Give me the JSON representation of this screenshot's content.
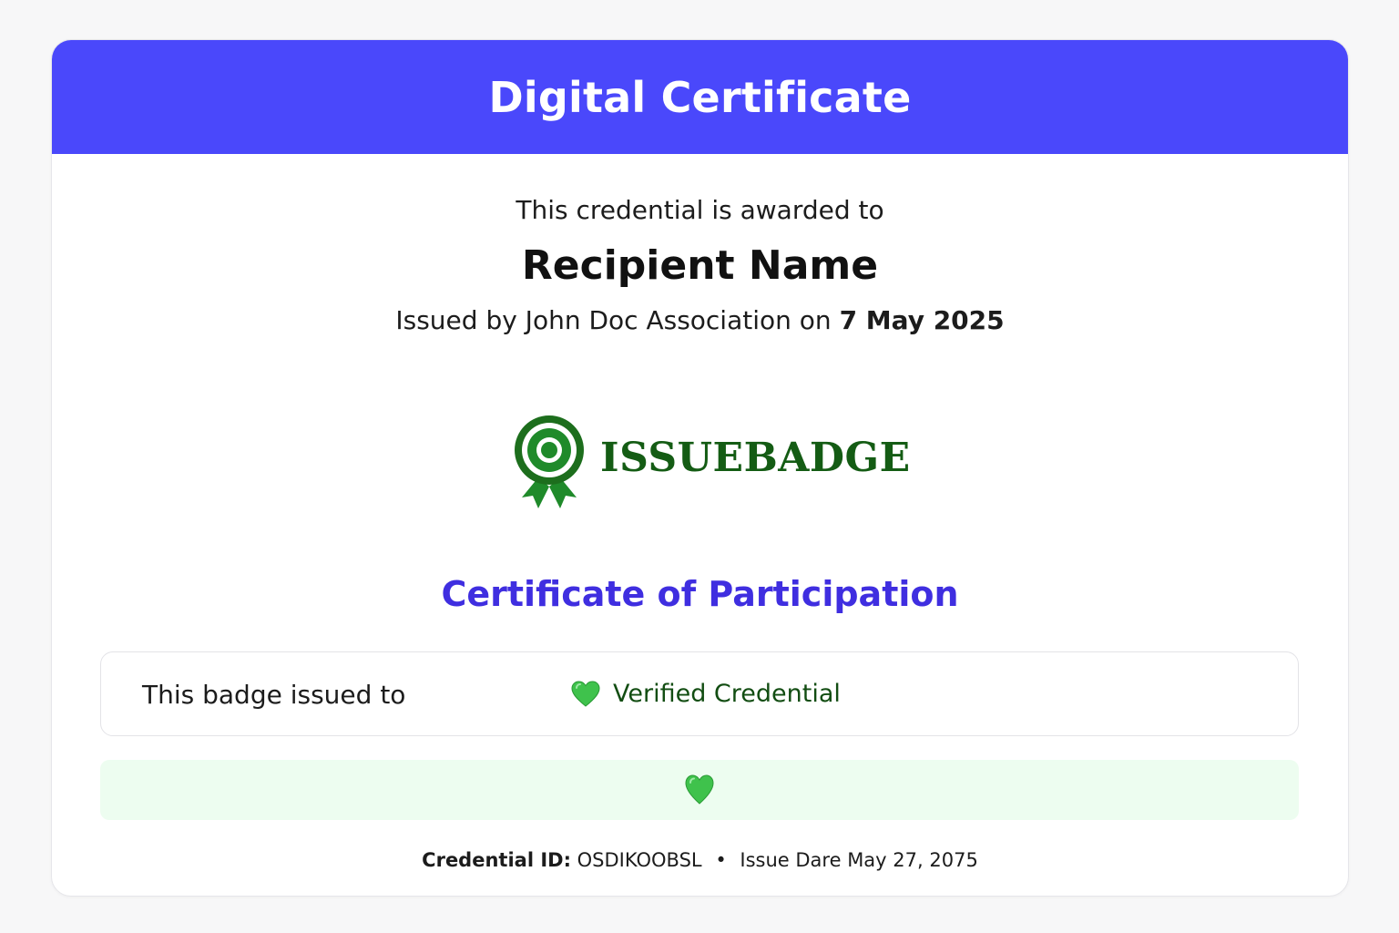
{
  "header": {
    "title": "Digital Certificate",
    "background_color": "#4a48fb"
  },
  "certificate": {
    "awarded_text": "This credential is awarded to",
    "recipient_name": "Recipient Name",
    "issued_prefix": "Issued by John Doc Association on ",
    "issued_date": "7 May 2025",
    "type": "Certificate of Participation",
    "type_color": "#3f2ee0"
  },
  "logo": {
    "icon": "award-ribbon-icon",
    "text": "ISSUEBADGE",
    "color": "#145c14"
  },
  "info_box": {
    "label": "This badge issued to",
    "verified_icon": "green-heart-icon",
    "verified_text": "Verified Credential"
  },
  "status_bar": {
    "icon": "green-heart-icon",
    "background_color": "#edfdf0"
  },
  "footer": {
    "credential_id_label": "Credential ID:",
    "credential_id_value": "OSDIKOOBSL",
    "separator": "•",
    "issue_date_text": "Issue Dare May 27, 2075"
  }
}
